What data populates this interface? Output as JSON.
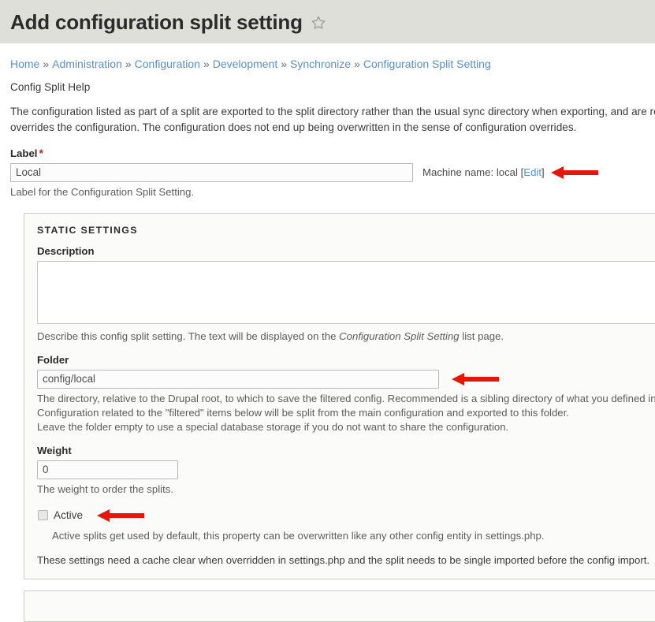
{
  "header": {
    "title": "Add configuration split setting",
    "star_icon": "star-outline-icon"
  },
  "breadcrumb": {
    "items": [
      {
        "label": "Home"
      },
      {
        "label": "Administration"
      },
      {
        "label": "Configuration"
      },
      {
        "label": "Development"
      },
      {
        "label": "Synchronize"
      },
      {
        "label": "Configuration Split Setting"
      }
    ],
    "separator": "»"
  },
  "help": {
    "title": "Config Split Help",
    "body": "The configuration listed as part of a split are exported to the split directory rather than the usual sync directory when exporting, and are read from there when importing. A split directory and overrides the configuration. The configuration does not end up being overwritten in the sense of configuration overrides."
  },
  "label_field": {
    "label": "Label",
    "required_mark": "*",
    "value": "Local",
    "placeholder": "",
    "machine_name_prefix": "Machine name: ",
    "machine_name_value": "local",
    "machine_name_edit_open": " [",
    "machine_name_edit": "Edit",
    "machine_name_edit_close": "]",
    "description": "Label for the Configuration Split Setting."
  },
  "static_settings": {
    "legend": "STATIC SETTINGS",
    "description_field": {
      "label": "Description",
      "value": "",
      "placeholder": "",
      "help_before": "Describe this config split setting. The text will be displayed on the ",
      "help_italic": "Configuration Split Setting",
      "help_after": " list page."
    },
    "folder_field": {
      "label": "Folder",
      "value": "config/local",
      "placeholder": "",
      "help_line_1": "The directory, relative to the Drupal root, to which to save the filtered config. Recommended is a sibling directory of what you defined in $settings[\"config_sync_directory\"].",
      "help_line_2": "Configuration related to the \"filtered\" items below will be split from the main configuration and exported to this folder.",
      "help_line_3": "Leave the folder empty to use a special database storage if you do not want to share the configuration."
    },
    "weight_field": {
      "label": "Weight",
      "value": "0",
      "placeholder": "",
      "help": "The weight to order the splits."
    },
    "active_field": {
      "label": "Active",
      "checked": false,
      "help": "Active splits get used by default, this property can be overwritten like any other config entity in settings.php."
    },
    "footer_note": "These settings need a cache clear when overridden in settings.php and the split needs to be single imported before the config import."
  },
  "annotations": {
    "arrow_color": "#e5170b",
    "arrows": [
      {
        "name": "machine-name-arrow",
        "direction": "left"
      },
      {
        "name": "folder-arrow",
        "direction": "left"
      },
      {
        "name": "active-arrow",
        "direction": "left"
      }
    ]
  },
  "colors": {
    "header_bg": "#dedfd8",
    "link": "#5a90c4",
    "required": "#e31616",
    "panel_bg": "#fbfbfa",
    "panel_border": "#ccccc6"
  }
}
